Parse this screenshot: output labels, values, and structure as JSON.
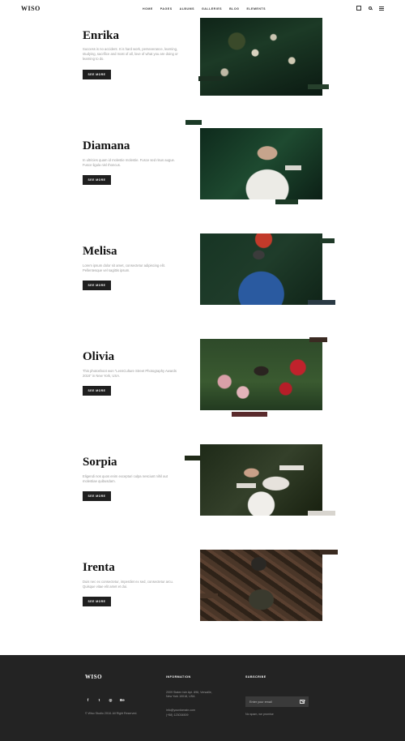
{
  "header": {
    "logo": "WISO",
    "nav": [
      "HOME",
      "PAGES",
      "ALBUMS",
      "GALLERIES",
      "BLOG",
      "ELEMENTS"
    ]
  },
  "items": [
    {
      "title": "Enrika",
      "text": "Success is no accident. It is hard work, perseverance, learning, studying, sacrifice and most of all, love of what you are doing or learning to do.",
      "button": "SEE MORE"
    },
    {
      "title": "Diamana",
      "text": "In ultricies quam id molestie molestie. Fusce sed risus augue. Fusce ligula nisl rhoncus.",
      "button": "SEE MORE"
    },
    {
      "title": "Melisa",
      "text": "Lorem ipsum dolor sit amet, consectetur adipiscing elit. Pellentesque vel sagittis ipsum.",
      "button": "SEE MORE"
    },
    {
      "title": "Olivia",
      "text": "This photoshoot won \"LensCulture Street Photography Awards 2016\" in New York, USA.",
      "button": "SEE MORE"
    },
    {
      "title": "Sorpia",
      "text": "Eligendi nos quos enim excepturi culpa nesciunt nihil aut molestiae quibusdam.",
      "button": "SEE MORE"
    },
    {
      "title": "Irenta",
      "text": "Duis nec ex consectetur, imperdiet ex sed, consectetur arcu. Quisque vitae elit amet et dui.",
      "button": "SEE MORE"
    }
  ],
  "footer": {
    "logo": "WISO",
    "social": [
      "f",
      "t",
      "◎",
      "Be"
    ],
    "copyright": "© Wiso Studio 2018. All Right Reserved.",
    "info_heading": "INFORMATION",
    "address_line1": "2009 Staten Isle Apt. 896, Versaille,",
    "address_line2": "New York 10018, USA",
    "email": "info@yourdomain.com",
    "phone": "(+58) 123034509",
    "subscribe_heading": "SUBSCRIBE",
    "subscribe_placeholder": "Enter your email",
    "subscribe_note": "No spam, we promise"
  }
}
